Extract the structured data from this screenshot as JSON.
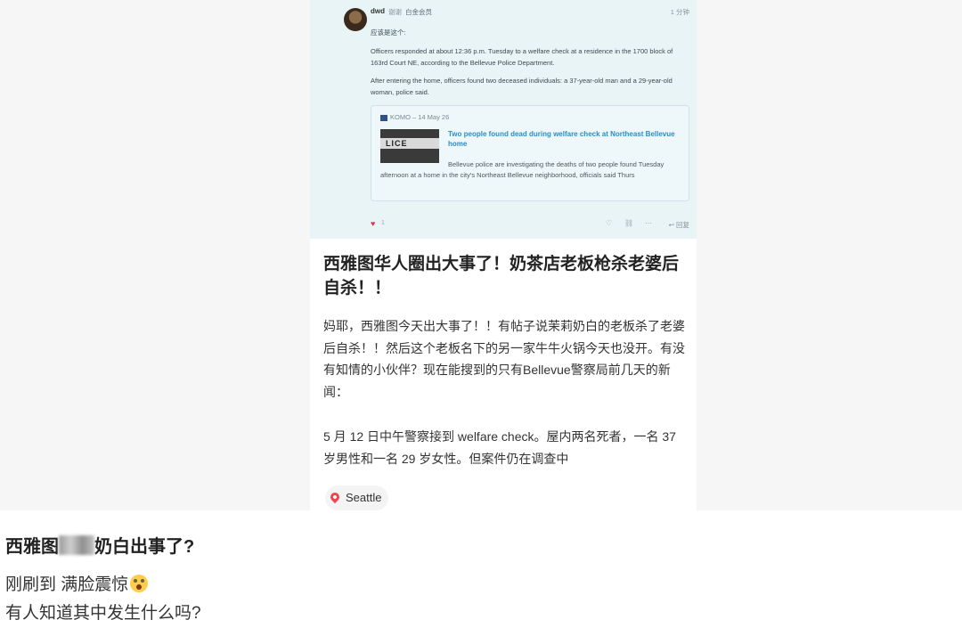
{
  "forum": {
    "username": "dwd",
    "handle": "谢谢",
    "badge": "白金会员",
    "time": "1 分钟",
    "lines": [
      "应该是这个:",
      "Officers responded at about 12:36 p.m. Tuesday to a welfare check at a residence in the 1700 block of 163rd Court NE, according to the Bellevue Police Department.",
      "After entering the home, officers found two deceased individuals: a 37-year-old man and a 29-year-old woman, police said."
    ],
    "link_card": {
      "source": "KOMO – 14 May 26",
      "thumb_text": "LICE",
      "title": "Two people found dead during welfare check at Northeast Bellevue home",
      "description": "Bellevue police are investigating the deaths of two people found Tuesday afternoon at a home in the city's Northeast Bellevue neighborhood, officials said Thurs"
    },
    "likes": "1",
    "reply_label": "回复"
  },
  "post": {
    "title": "西雅图华人圈出大事了！奶茶店老板枪杀老婆后自杀！！",
    "paragraph1": "妈耶，西雅图今天出大事了！！有帖子说茉莉奶白的老板杀了老婆后自杀！！然后这个老板名下的另一家牛牛火锅今天也没开。有没有知情的小伙伴？现在能搜到的只有Bellevue警察局前几天的新闻：",
    "paragraph2": " 5 月 12 日中午警察接到 welfare check。屋内两名死者，一名 37 岁男性和一名 29 岁女性。但案件仍在调查中",
    "location": "Seattle"
  },
  "bottom": {
    "title_left": "西雅图",
    "title_right": "奶白出事了?",
    "line1": "刚刷到 满脸震惊",
    "line2": "有人知道其中发生什么吗?",
    "emoji_icon": "shocked-face-emoji"
  }
}
